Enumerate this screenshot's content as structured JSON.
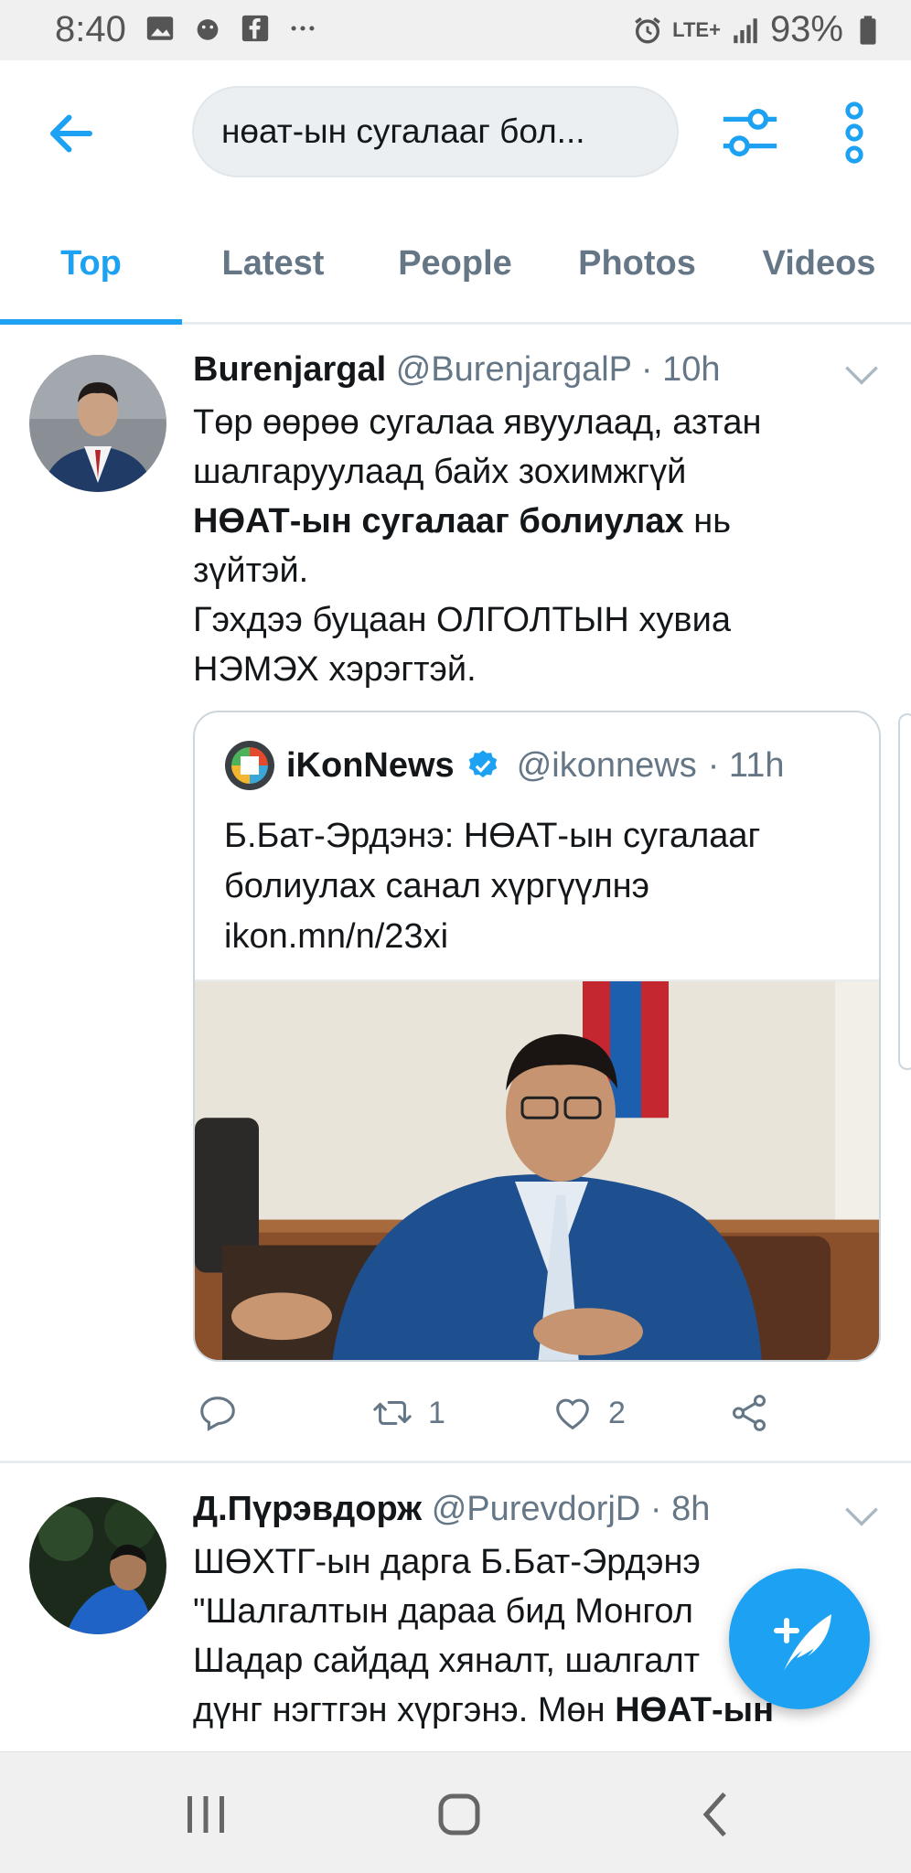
{
  "status_bar": {
    "time": "8:40",
    "left_icons": [
      "image-icon",
      "emoji-icon",
      "facebook-icon",
      "more-dots-icon"
    ],
    "network": "LTE+",
    "battery": "93%"
  },
  "header": {
    "search_query": "нөат-ын сугалааг бол...",
    "back_icon": "arrow-left-icon",
    "filter_icon": "sliders-icon",
    "more_icon": "vertical-dots-icon"
  },
  "tabs": [
    {
      "label": "Top",
      "active": true
    },
    {
      "label": "Latest",
      "active": false
    },
    {
      "label": "People",
      "active": false
    },
    {
      "label": "Photos",
      "active": false
    },
    {
      "label": "Videos",
      "active": false
    }
  ],
  "tweets": [
    {
      "name": "Burenjargal",
      "handle": "@BurenjargalP",
      "time": "· 10h",
      "text_line1": "Төр өөрөө сугалаа явуулаад, азтан",
      "text_line2": "шалгаруулаад байх зохимжгүй",
      "text_bold": "НӨАТ-ын сугалааг болиулах",
      "text_after_bold": " нь",
      "text_line4": "зүйтэй.",
      "text_line5": "Гэхдээ буцаан ОЛГОЛТЫН хувиа",
      "text_line6": "НЭМЭХ хэрэгтэй.",
      "quote": {
        "name": "iKonNews",
        "handle": "@ikonnews",
        "time": "· 11h",
        "text_line1": "Б.Бат-Эрдэнэ: НӨАТ-ын сугалааг",
        "text_line2": "болиулах санал хүргүүлнэ",
        "text_line3": "ikon.mn/n/23xi"
      },
      "retweets": "1",
      "likes": "2"
    },
    {
      "name": "Д.Пүрэвдорж",
      "handle": "@PurevdorjD",
      "time": "· 8h",
      "text_line1": "ШӨХТГ-ын дарга Б.Бат-Эрдэнэ",
      "text_line2": "\"Шалгалтын дараа бид Монгол",
      "text_line3": "Шадар сайдад хяналт, шалгалт",
      "text_line4_pre": "дүнг нэгтгэн хүргэнэ. Мөн ",
      "text_line4_bold": "НӨАТ-ын"
    }
  ],
  "colors": {
    "accent": "#1da1f2",
    "secondary_text": "#657786",
    "divider": "#e6ecf0"
  }
}
